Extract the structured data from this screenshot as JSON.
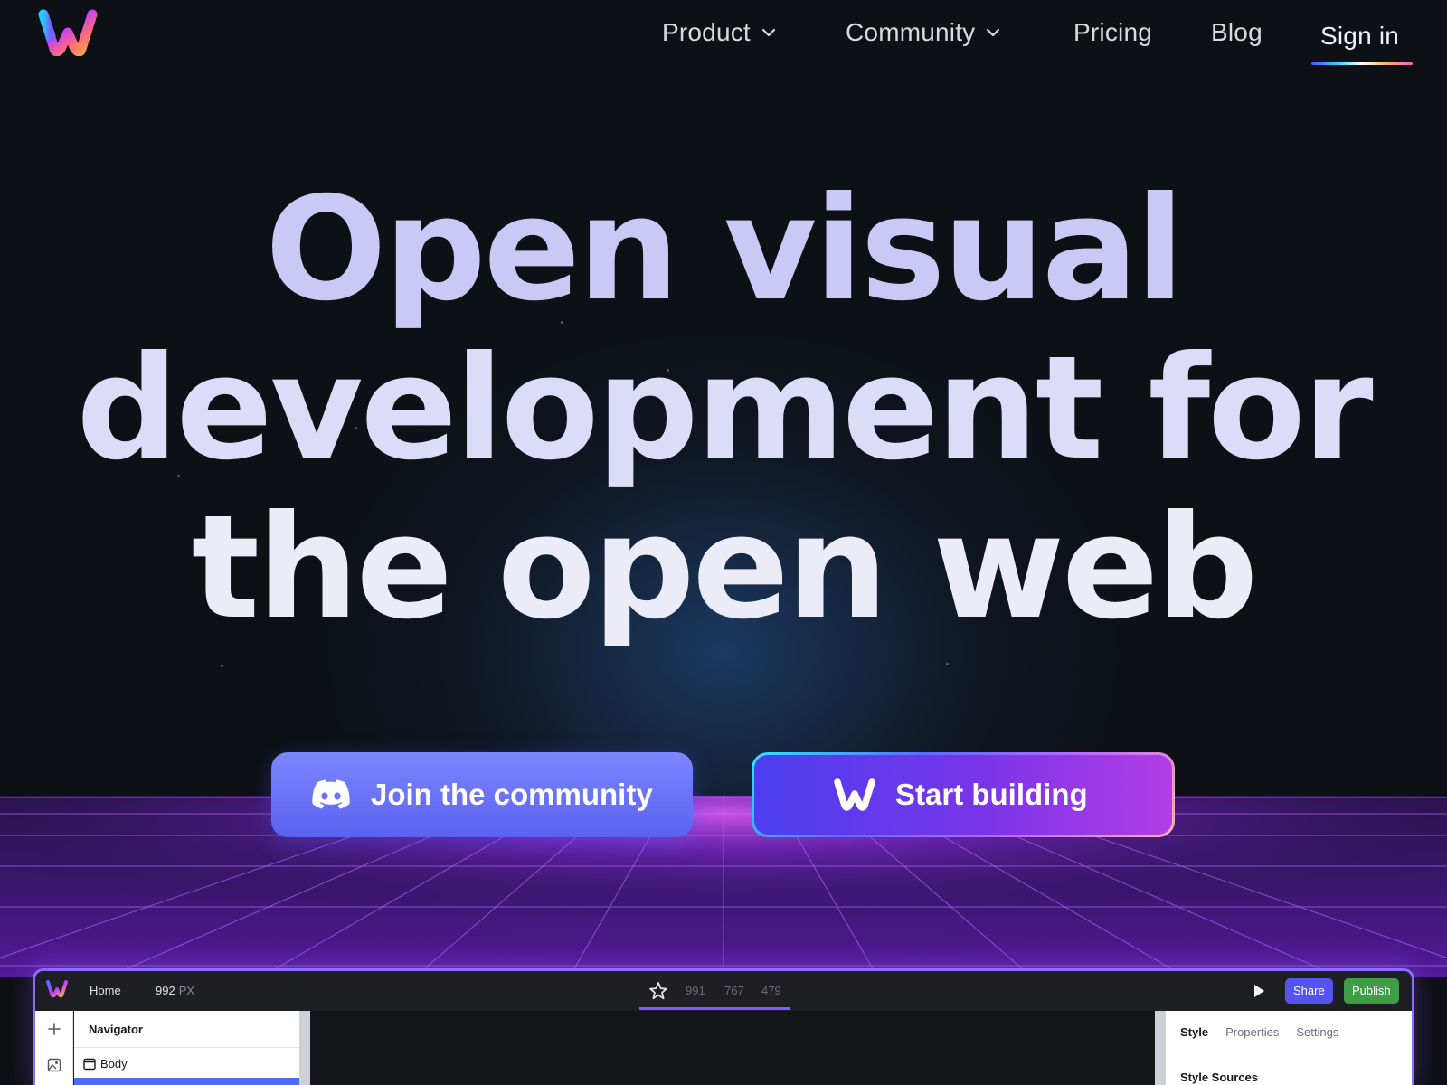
{
  "nav": {
    "product": "Product",
    "community": "Community",
    "pricing": "Pricing",
    "blog": "Blog",
    "signin": "Sign in"
  },
  "hero": {
    "line1": "Open visual",
    "line2": "development for",
    "line3": "the open web"
  },
  "cta": {
    "join": "Join the community",
    "start": "Start building"
  },
  "builder": {
    "page": "Home",
    "width_value": "992",
    "width_unit": "PX",
    "breakpoints": [
      "991",
      "767",
      "479"
    ],
    "share": "Share",
    "publish": "Publish",
    "navigator_title": "Navigator",
    "tree_root": "Body",
    "panel_tabs": [
      "Style",
      "Properties",
      "Settings"
    ],
    "style_sources": "Style Sources"
  },
  "colors": {
    "background": "#0d1014",
    "join_button": "#6b74fa",
    "start_button": "#7a34e8",
    "share": "#5454f0",
    "publish": "#3f9d47"
  }
}
